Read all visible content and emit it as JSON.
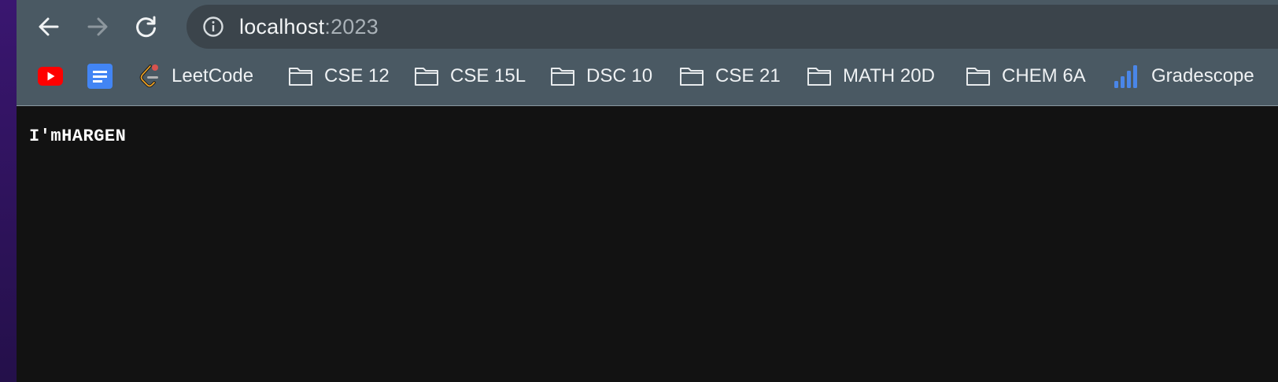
{
  "address_bar": {
    "host": "localhost",
    "port": ":2023"
  },
  "bookmarks": [
    {
      "label": "",
      "icon": "youtube-icon",
      "color": "#ff0000"
    },
    {
      "label": "",
      "icon": "google-docs-icon",
      "color": "#4285f4"
    },
    {
      "label": "LeetCode",
      "icon": "leetcode-icon"
    },
    {
      "label": "CSE 12",
      "icon": "folder-icon"
    },
    {
      "label": "CSE 15L",
      "icon": "folder-icon"
    },
    {
      "label": "DSC 10",
      "icon": "folder-icon"
    },
    {
      "label": "CSE 21",
      "icon": "folder-icon"
    },
    {
      "label": "MATH 20D",
      "icon": "folder-icon"
    },
    {
      "label": "CHEM 6A",
      "icon": "folder-icon"
    },
    {
      "label": "Gradescope",
      "icon": "gradescope-icon",
      "color": "#4a86e8"
    }
  ],
  "page": {
    "text": "I'mHARGEN"
  },
  "colors": {
    "toolbar": "#4a5963",
    "address_bar": "#3b444b",
    "page_background": "#121212"
  }
}
